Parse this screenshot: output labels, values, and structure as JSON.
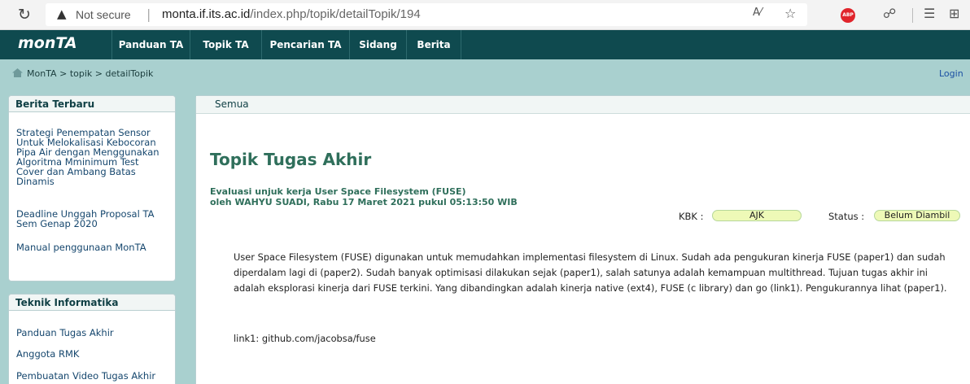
{
  "browser": {
    "security_label": "Not secure",
    "url_host": "monta.if.its.ac.id",
    "url_path": "/index.php/topik/detailTopik/194"
  },
  "nav": {
    "logo": "monTA",
    "items": [
      {
        "label": "Panduan TA"
      },
      {
        "label": "Topik TA"
      },
      {
        "label": "Pencarian TA"
      },
      {
        "label": "Sidang"
      },
      {
        "label": "Berita"
      }
    ]
  },
  "breadcrumb": {
    "items": [
      "MonTA",
      "topik",
      "detailTopik"
    ],
    "separator": ">"
  },
  "login_label": "Login",
  "sidebar": {
    "berita": {
      "title": "Berita Terbaru",
      "links": [
        "Strategi Penempatan Sensor Untuk Melokalisasi Kebocoran Pipa Air dengan Menggunakan Algoritma Mminimum Test Cover dan Ambang Batas Dinamis",
        "Deadline Unggah Proposal TA Sem Genap 2020",
        "Manual penggunaan MonTA"
      ]
    },
    "teknik": {
      "title": "Teknik Informatika",
      "links": [
        "Panduan Tugas Akhir",
        "Anggota RMK",
        "Pembuatan Video Tugas Akhir"
      ]
    }
  },
  "main": {
    "tab": "Semua",
    "title": "Topik Tugas Akhir",
    "topic_title": "Evaluasi unjuk kerja User Space Filesystem (FUSE)",
    "byline": "oleh WAHYU SUADI, Rabu 17 Maret 2021 pukul 05:13:50 WIB",
    "kbk_label": "KBK :",
    "kbk_value": "AJK",
    "status_label": "Status :",
    "status_value": "Belum Diambil",
    "description": "User Space Filesystem (FUSE) digunakan untuk memudahkan implementasi filesystem di Linux. Sudah ada pengukuran kinerja FUSE (paper1) dan sudah diperdalam lagi di (paper2). Sudah banyak optimisasi dilakukan sejak (paper1), salah satunya adalah kemampuan multithread. Tujuan tugas akhir ini adalah eksplorasi kinerja dari FUSE terkini. Yang dibandingkan adalah kinerja native (ext4), FUSE (c library) dan go (link1). Pengukurannya lihat (paper1).",
    "link_text": "link1: github.com/jacobsa/fuse"
  },
  "colors": {
    "nav_bg": "#0f4a4f",
    "page_bg": "#a9d0cf",
    "title_green": "#2f6f5b",
    "badge_bg": "#eef9b7"
  }
}
